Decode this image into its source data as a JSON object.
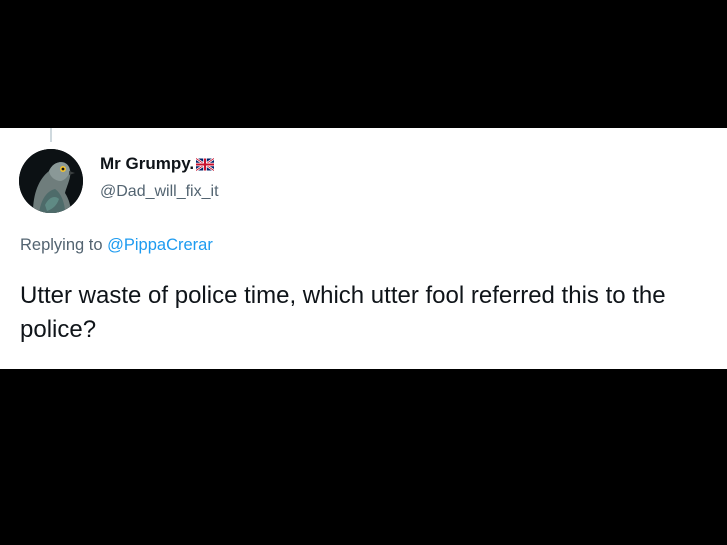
{
  "tweet": {
    "author": {
      "display_name": "Mr Grumpy.",
      "handle": "@Dad_will_fix_it",
      "avatar_icon": "pigeon-avatar-icon",
      "flag_icon": "uk-flag-icon"
    },
    "reply": {
      "prefix": "Replying to",
      "mention": "@PippaCrerar"
    },
    "text": "Utter waste of police time, which utter fool referred this to the police?"
  },
  "colors": {
    "background": "#000000",
    "card": "#ffffff",
    "text_primary": "#0f1419",
    "text_secondary": "#536471",
    "link": "#1d9bf0"
  }
}
